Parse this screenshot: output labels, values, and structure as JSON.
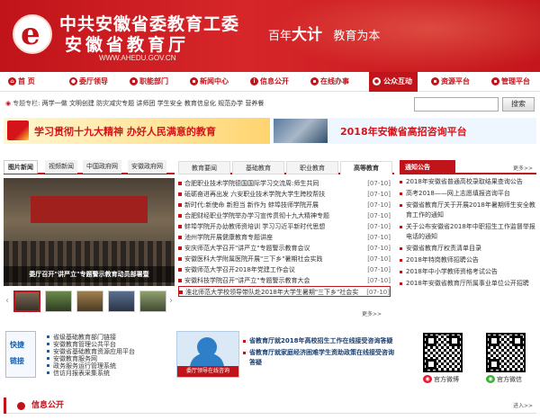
{
  "header": {
    "org_line1": "中共安徽省委教育工委",
    "org_line2": "安徽省教育厅",
    "url": "WWW.AHEDU.GOV.CN",
    "slogan_part1": "百年",
    "slogan_big": "大计",
    "slogan_part2": "教育为本",
    "colors": {
      "primary": "#c0141a"
    }
  },
  "nav": {
    "items": [
      {
        "label": "首 页",
        "icon": "home-icon"
      },
      {
        "label": "委厅领导",
        "icon": "person-icon"
      },
      {
        "label": "职能部门",
        "icon": "building-icon"
      },
      {
        "label": "新闻中心",
        "icon": "news-icon"
      },
      {
        "label": "信息公开",
        "icon": "info-icon"
      },
      {
        "label": "在线办事",
        "icon": "service-icon"
      },
      {
        "label": "公众互动",
        "icon": "chat-icon"
      },
      {
        "label": "资源平台",
        "icon": "resource-icon"
      },
      {
        "label": "管理平台",
        "icon": "manage-icon"
      }
    ],
    "active_index": 6
  },
  "topics": {
    "label": "专题专栏:",
    "items": [
      "两学一做",
      "文明创建",
      "防灾减灾专题",
      "讲师团",
      "学生安全",
      "教育信息化",
      "规范办学",
      "营养餐"
    ]
  },
  "search": {
    "button": "搜索"
  },
  "banners": {
    "left": "学习贯彻十九大精神  办好人民满意的教育",
    "right": "2018年安徽省高招咨询平台"
  },
  "photo_news": {
    "tabs": [
      "图片新闻",
      "视频新闻",
      "中国政府网",
      "安徽政府网"
    ],
    "caption": "委厅召开\"讲严立\"专题警示教育动员部署暨"
  },
  "news": {
    "tabs": [
      "教育要闻",
      "基础教育",
      "职业教育",
      "高等教育"
    ],
    "active_tab": 3,
    "items": [
      {
        "title": "合肥职业技术学院德国国际学习交流周:师生共同",
        "date": "[07-10]"
      },
      {
        "title": "砥砺奋进再出发 六安职业技术学院大学生跨校帮扶",
        "date": "[07-10]"
      },
      {
        "title": "新时代:新使命 新担当 新作为 蚌埠技师学院开展",
        "date": "[07-10]"
      },
      {
        "title": "合肥财经职业学院举办学习宣传贯彻十九大精神专题",
        "date": "[07-10]"
      },
      {
        "title": "蚌埠学院开办幼教师资培训 学习习近平新时代思想",
        "date": "[07-10]"
      },
      {
        "title": "池州学院开展健康教育专题讲座",
        "date": "[07-10]"
      },
      {
        "title": "安庆师范大学召开\"讲严立\"专题警示教育会议",
        "date": "[07-10]"
      },
      {
        "title": "安徽医科大学附属医院开展\"三下乡\"暑期社会实践",
        "date": "[07-10]"
      },
      {
        "title": "安徽师范大学召开2018年党建工作会议",
        "date": "[07-10]"
      },
      {
        "title": "安徽科技学院召开\"讲严立\"专题警示教育大会",
        "date": "[07-10]"
      },
      {
        "title": "淮北师范大学校领导带队赴2018年大学生暑期\"三下乡\"社会实践",
        "date": "[07-10]"
      }
    ],
    "more": "更多>>"
  },
  "notices": {
    "title": "通知公告",
    "more": "更多>>",
    "items": [
      "2018年安徽省普通高校录取结果查询公告",
      "高考2018——网上志愿填报咨询平台",
      "安徽省教育厅关于开展2018年暑期师生安全教育工作的通知",
      "关于公布安徽省2018年中职招生工作监督举报电话的通知",
      "安徽省教育厅权责清单目录",
      "2018年特岗教师招聘公告",
      "2018年中小学教师资格考试公告",
      "2018年安徽省教育厅所属事业单位公开招聘"
    ]
  },
  "quick_links": {
    "title1": "快捷",
    "title2": "链接",
    "items": [
      "省级基础教育部门链接",
      "安徽教育管理公共平台",
      "安徽省基础教育资源应用平台",
      "安徽教育服务网",
      "政务服务运行管理系统",
      "信访月报表采集系统"
    ]
  },
  "leader_online": {
    "caption": "委厅领导在线咨询",
    "items": [
      "省教育厅就2018年高校招生工作在线接受咨询答疑",
      "省教育厅就家庭经济困难学生资助政策在线接受咨询答疑"
    ]
  },
  "social": {
    "weibo": "官方微博",
    "wechat": "官方微信"
  },
  "info_open": {
    "title": "信息公开",
    "enter": "进入>>"
  }
}
